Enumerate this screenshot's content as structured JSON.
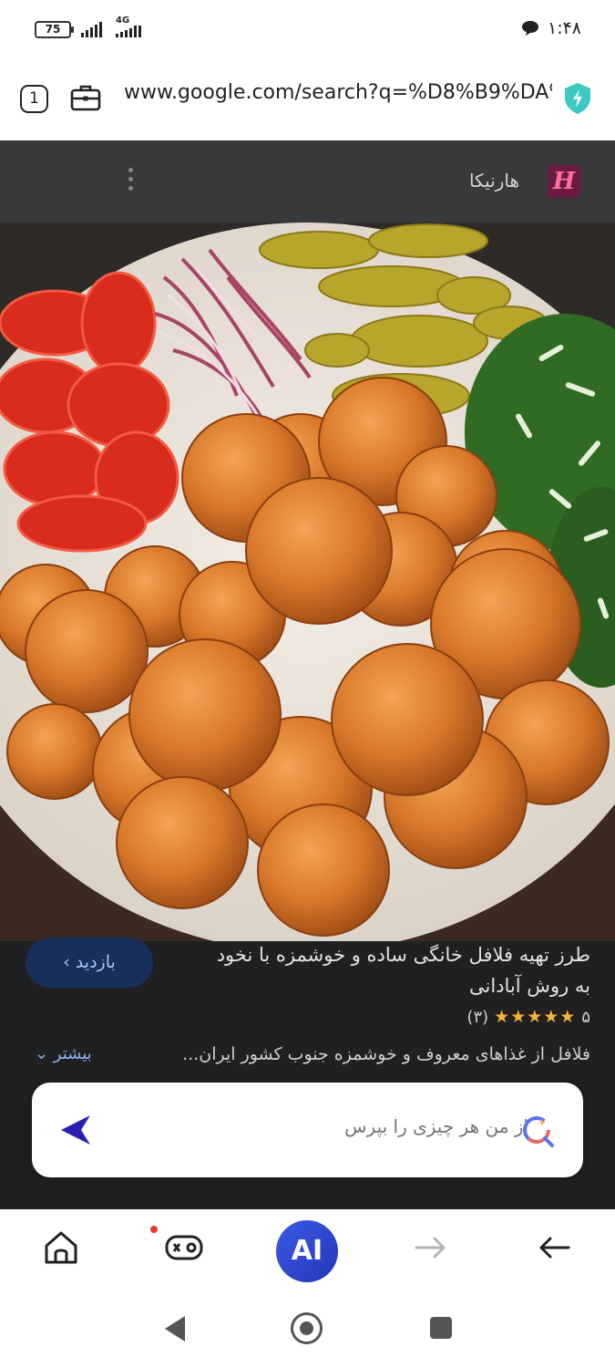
{
  "status_bar": {
    "battery": "75",
    "network": "4G",
    "time": "۱:۴۸"
  },
  "browser": {
    "tab_count": "1",
    "url": "www.google.com/search?q=%D8%B9%DA%"
  },
  "site": {
    "name": "هارنیکا",
    "logo_letter": "H"
  },
  "result": {
    "visit_label": "بازدید ›",
    "title": "طرز تهیه فلافل خانگی ساده و خوشمزه با نخود به روش آبادانی",
    "rating_value": "۵",
    "stars": "★★★★★",
    "rating_count": "(۳)",
    "snippet": "فلافل از غذاهای معروف و خوشمزه جنوب کشور ایران...",
    "more_label": "بیشتر ⌄"
  },
  "ask_box": {
    "placeholder": "از من هر چیزی را بپرس"
  },
  "bottom_nav": {
    "ai_label": "AI"
  },
  "icons": [
    "battery-icon",
    "signal-icon",
    "chat-icon",
    "briefcase-icon",
    "shield-icon",
    "kebab-icon",
    "send-icon",
    "ai-search-icon",
    "home-icon",
    "gamepad-icon",
    "forward-arrow-icon",
    "back-arrow-icon"
  ],
  "colors": {
    "accent": "#2f46d0",
    "visit_button_bg": "#17305a",
    "star": "#f2b43b",
    "logo_bg": "#6b1a44"
  }
}
